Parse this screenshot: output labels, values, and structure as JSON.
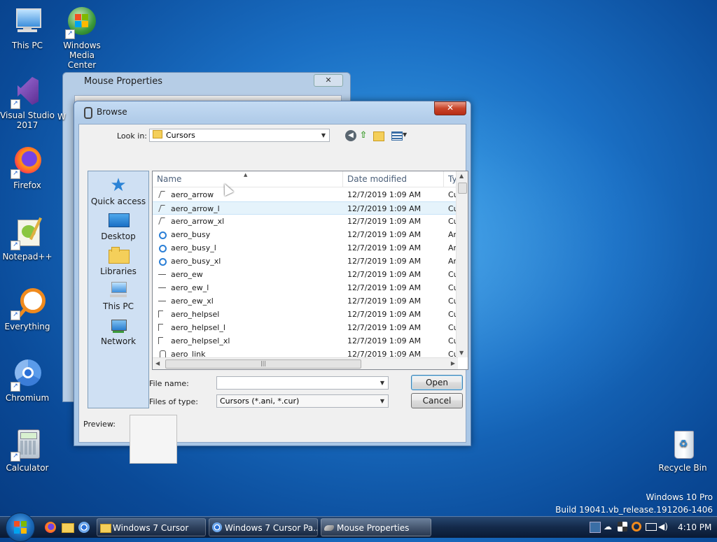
{
  "desktop": {
    "icons": [
      {
        "label": "This PC"
      },
      {
        "label": "Windows\nMedia Center"
      },
      {
        "label": "Visual Studio\n2017"
      },
      {
        "label": "Firefox"
      },
      {
        "label": "Notepad++"
      },
      {
        "label": "Everything"
      },
      {
        "label": "Chromium"
      },
      {
        "label": "Calculator"
      },
      {
        "label": "Recycle Bin"
      }
    ],
    "watermark_line1": "Windows 10 Pro",
    "watermark_line2": "Build 19041.vb_release.191206-1406",
    "truncated_label": "W"
  },
  "mouse_properties": {
    "title": "Mouse Properties",
    "close_glyph": "✕"
  },
  "browse": {
    "title": "Browse",
    "close_glyph": "✕",
    "look_in_label": "Look in:",
    "look_in_value": "Cursors",
    "columns": {
      "name": "Name",
      "date": "Date modified",
      "type": "Ty"
    },
    "files": [
      {
        "name": "aero_arrow",
        "date": "12/7/2019 1:09 AM",
        "type": "Cu",
        "icon": "arrow"
      },
      {
        "name": "aero_arrow_l",
        "date": "12/7/2019 1:09 AM",
        "type": "Cu",
        "icon": "arrow"
      },
      {
        "name": "aero_arrow_xl",
        "date": "12/7/2019 1:09 AM",
        "type": "Cu",
        "icon": "arrow"
      },
      {
        "name": "aero_busy",
        "date": "12/7/2019 1:09 AM",
        "type": "Ar",
        "icon": "busy"
      },
      {
        "name": "aero_busy_l",
        "date": "12/7/2019 1:09 AM",
        "type": "Ar",
        "icon": "busy"
      },
      {
        "name": "aero_busy_xl",
        "date": "12/7/2019 1:09 AM",
        "type": "Ar",
        "icon": "busy"
      },
      {
        "name": "aero_ew",
        "date": "12/7/2019 1:09 AM",
        "type": "Cu",
        "icon": "ew"
      },
      {
        "name": "aero_ew_l",
        "date": "12/7/2019 1:09 AM",
        "type": "Cu",
        "icon": "ew"
      },
      {
        "name": "aero_ew_xl",
        "date": "12/7/2019 1:09 AM",
        "type": "Cu",
        "icon": "ew"
      },
      {
        "name": "aero_helpsel",
        "date": "12/7/2019 1:09 AM",
        "type": "Cu",
        "icon": "help"
      },
      {
        "name": "aero_helpsel_l",
        "date": "12/7/2019 1:09 AM",
        "type": "Cu",
        "icon": "help"
      },
      {
        "name": "aero_helpsel_xl",
        "date": "12/7/2019 1:09 AM",
        "type": "Cu",
        "icon": "help"
      },
      {
        "name": "aero_link",
        "date": "12/7/2019 1:09 AM",
        "type": "Cu",
        "icon": "link"
      }
    ],
    "places": [
      {
        "label": "Quick access",
        "icon": "star-icon"
      },
      {
        "label": "Desktop",
        "icon": "desktop-icon"
      },
      {
        "label": "Libraries",
        "icon": "libraries-icon"
      },
      {
        "label": "This PC",
        "icon": "computer-icon"
      },
      {
        "label": "Network",
        "icon": "network-icon"
      }
    ],
    "file_name_label": "File name:",
    "file_name_value": "",
    "files_of_type_label": "Files of type:",
    "files_of_type_value": "Cursors (*.ani, *.cur)",
    "open_label": "Open",
    "cancel_label": "Cancel",
    "preview_label": "Preview:"
  },
  "taskbar": {
    "tasks": [
      {
        "label": "Windows 7 Cursor",
        "icon": "folder-icon"
      },
      {
        "label": "Windows 7 Cursor Pa...",
        "icon": "chromium-icon"
      },
      {
        "label": "Mouse Properties",
        "icon": "mouse-icon"
      }
    ],
    "clock": "4:10 PM"
  }
}
